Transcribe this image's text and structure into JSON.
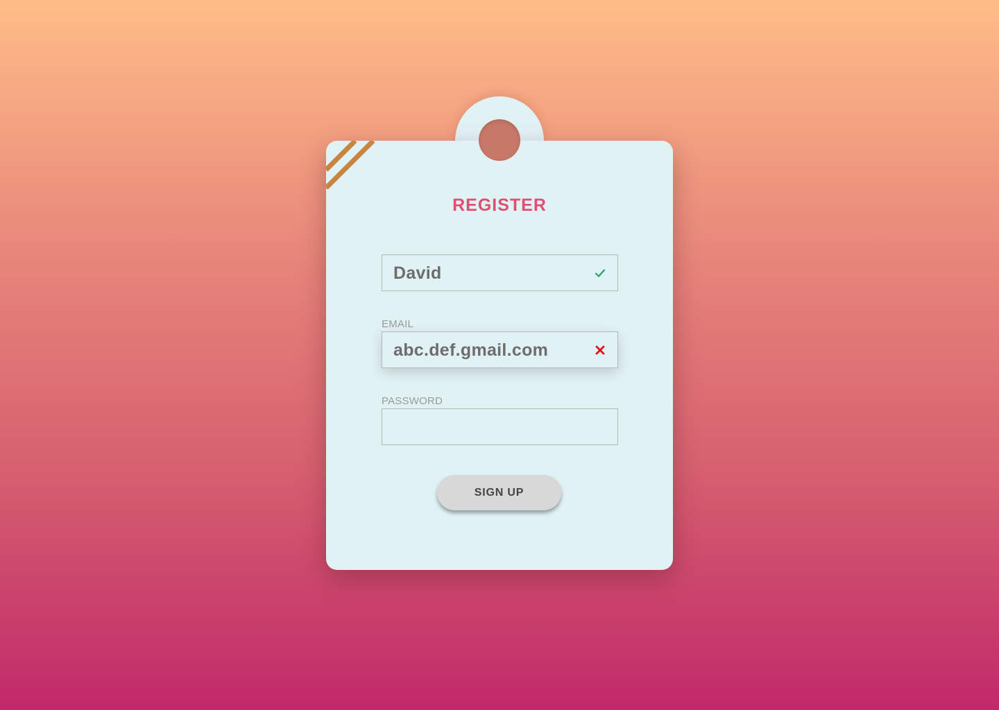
{
  "form": {
    "title": "REGISTER",
    "name_field": {
      "value": "David",
      "status": "valid",
      "status_icon": "check-icon",
      "status_color": "#21a06b"
    },
    "email_field": {
      "label": "EMAIL",
      "value": "abc.def.gmail.com",
      "status": "invalid",
      "status_icon": "close-icon",
      "status_color": "#e0101a"
    },
    "password_field": {
      "label": "PASSWORD",
      "value": ""
    },
    "submit_label": "SIGN UP"
  },
  "colors": {
    "title": "#e14e73",
    "card": "#e1f2f5",
    "stripe": "#c98440",
    "background_top": "#ffbc87",
    "background_bottom": "#c1296a"
  }
}
